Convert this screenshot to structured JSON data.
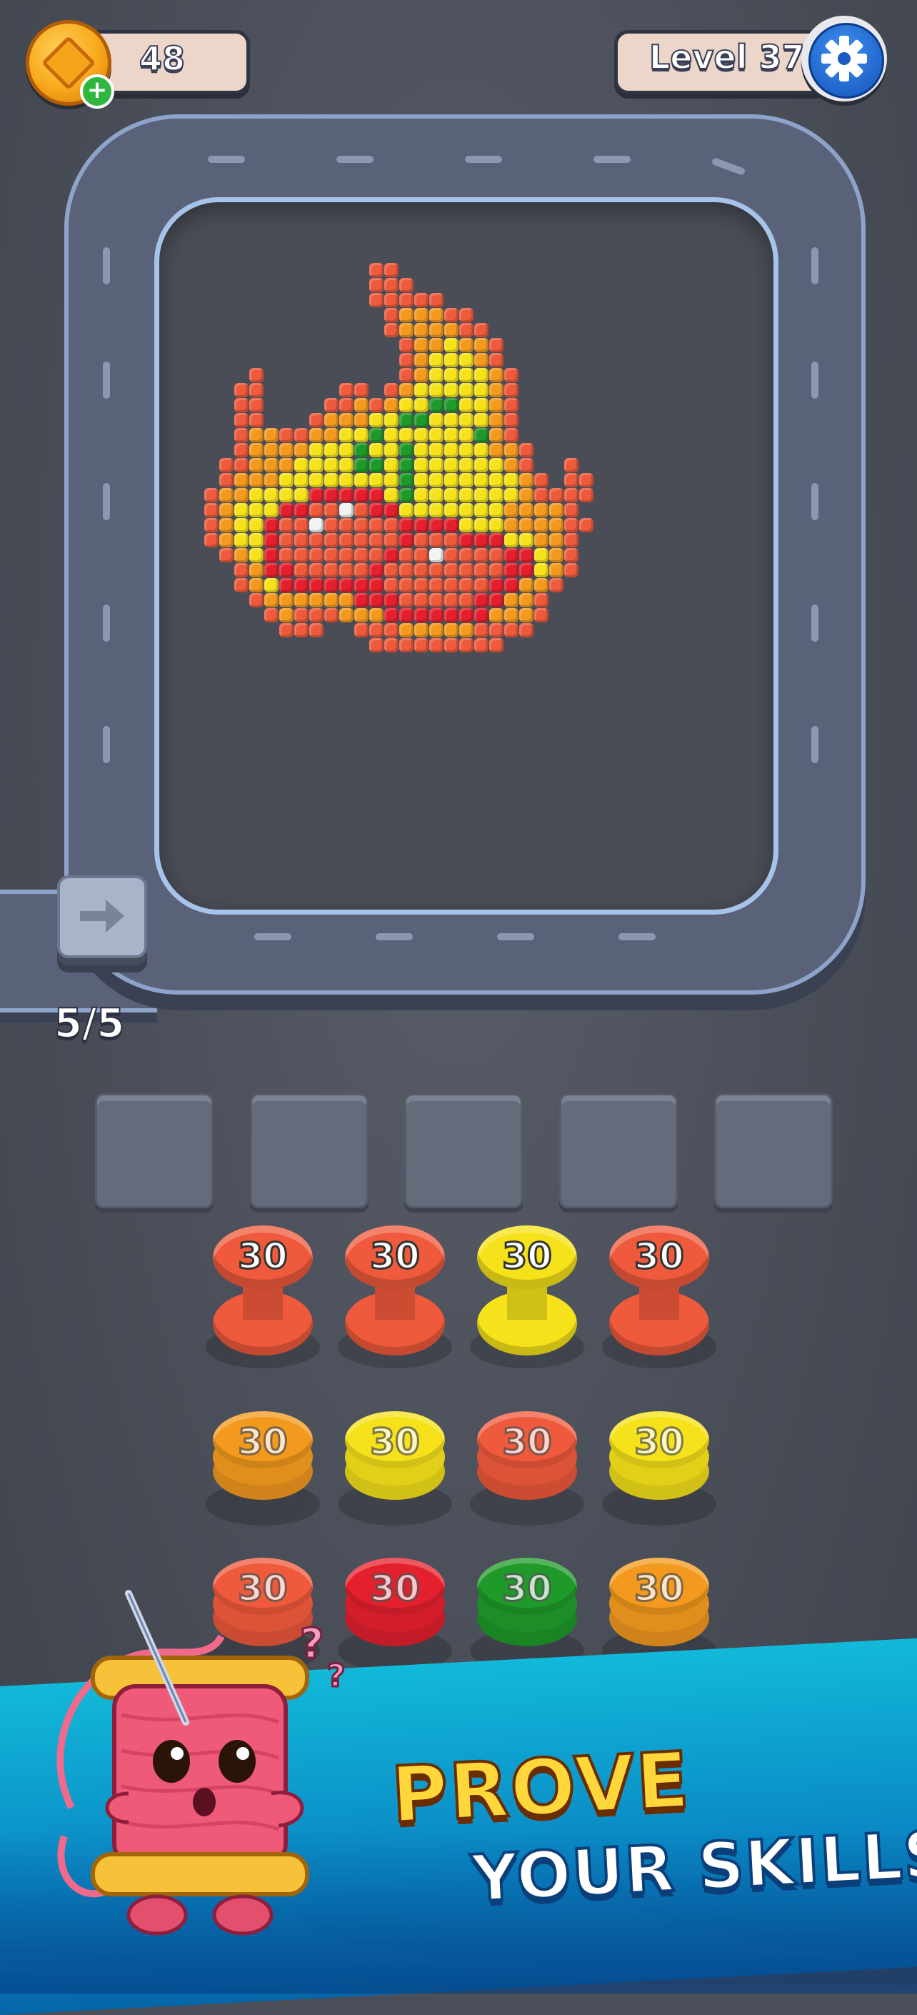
{
  "header": {
    "coins": "48",
    "level": "Level 37"
  },
  "board": {
    "queue_counter": "5/5",
    "slots": 5
  },
  "spools": {
    "rows": [
      [
        {
          "label": "30",
          "color": "#ef5a3c"
        },
        {
          "label": "30",
          "color": "#ef5a3c"
        },
        {
          "label": "30",
          "color": "#f6e21a"
        },
        {
          "label": "30",
          "color": "#ef5a3c"
        }
      ],
      [
        {
          "label": "30",
          "color": "#f39a1e"
        },
        {
          "label": "30",
          "color": "#f6e21a"
        },
        {
          "label": "30",
          "color": "#ef5a3c"
        },
        {
          "label": "30",
          "color": "#f6e21a"
        }
      ],
      [
        {
          "label": "30",
          "color": "#ef5a3c"
        },
        {
          "label": "30",
          "color": "#e5202e"
        },
        {
          "label": "30",
          "color": "#1f9a2a"
        },
        {
          "label": "30",
          "color": "#f39a1e"
        }
      ]
    ]
  },
  "banner": {
    "line1": "PROVE",
    "line2": "YOUR SKILLS"
  },
  "colors": {
    "coin": "#f7a81b",
    "settings": "#1f66d4",
    "banner": "#0a9bd0",
    "yarn_red": "#e5202e",
    "yarn_coral": "#ee5a3c",
    "yarn_orange": "#f39a1e",
    "yarn_yellow": "#f6e21a",
    "yarn_green": "#1f9a2a",
    "yarn_white": "#f2f2f2"
  },
  "icons": [
    "coin-icon",
    "plus-icon",
    "gear-icon",
    "arrow-right-icon",
    "needle-spool-mascot"
  ]
}
